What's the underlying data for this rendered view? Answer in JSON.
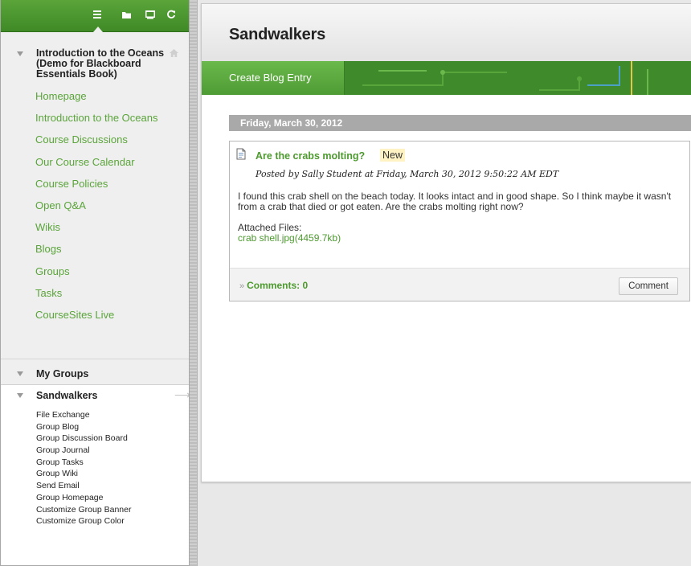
{
  "colors": {
    "brand_green": "#4d9a2f",
    "toolbar_green": "#3f8a26",
    "link_green": "#5aa43a",
    "date_bar": "#a9a9a9",
    "new_badge_bg": "#fff3c4"
  },
  "menu_toolbar": {
    "icons": [
      "course-menu-list-icon",
      "folder-view-icon",
      "new-window-icon",
      "refresh-icon"
    ]
  },
  "course_menu": {
    "course_title": "Introduction to the Oceans (Demo for Blackboard Essentials Book)",
    "links": [
      "Homepage",
      "Introduction to the Oceans",
      "Course Discussions",
      "Our Course Calendar",
      "Course Policies",
      "Open Q&A",
      "Wikis",
      "Blogs",
      "Groups",
      "Tasks",
      "CourseSites Live"
    ]
  },
  "my_groups": {
    "heading": "My Groups",
    "group_name": "Sandwalkers",
    "tools": [
      "File Exchange",
      "Group Blog",
      "Group Discussion Board",
      "Group Journal",
      "Group Tasks",
      "Group Wiki",
      "Send Email",
      "Group Homepage",
      "Customize Group Banner",
      "Customize Group Color"
    ]
  },
  "page": {
    "title": "Sandwalkers",
    "create_button": "Create Blog Entry"
  },
  "blog": {
    "date_header": "Friday, March 30, 2012",
    "entry": {
      "title": "Are the crabs molting?",
      "badge": "New",
      "meta": "Posted by Sally Student at Friday, March 30, 2012 9:50:22 AM EDT",
      "body": "I found this crab shell on the beach today. It looks intact and in good shape. So I think maybe it wasn't from a crab that died or got eaten. Are the crabs molting right now?",
      "attached_label": "Attached Files:",
      "attached_file": "crab shell.jpg(4459.7kb)",
      "comments_label": "Comments: 0",
      "comments_chevron": "»",
      "comment_button": "Comment"
    }
  }
}
